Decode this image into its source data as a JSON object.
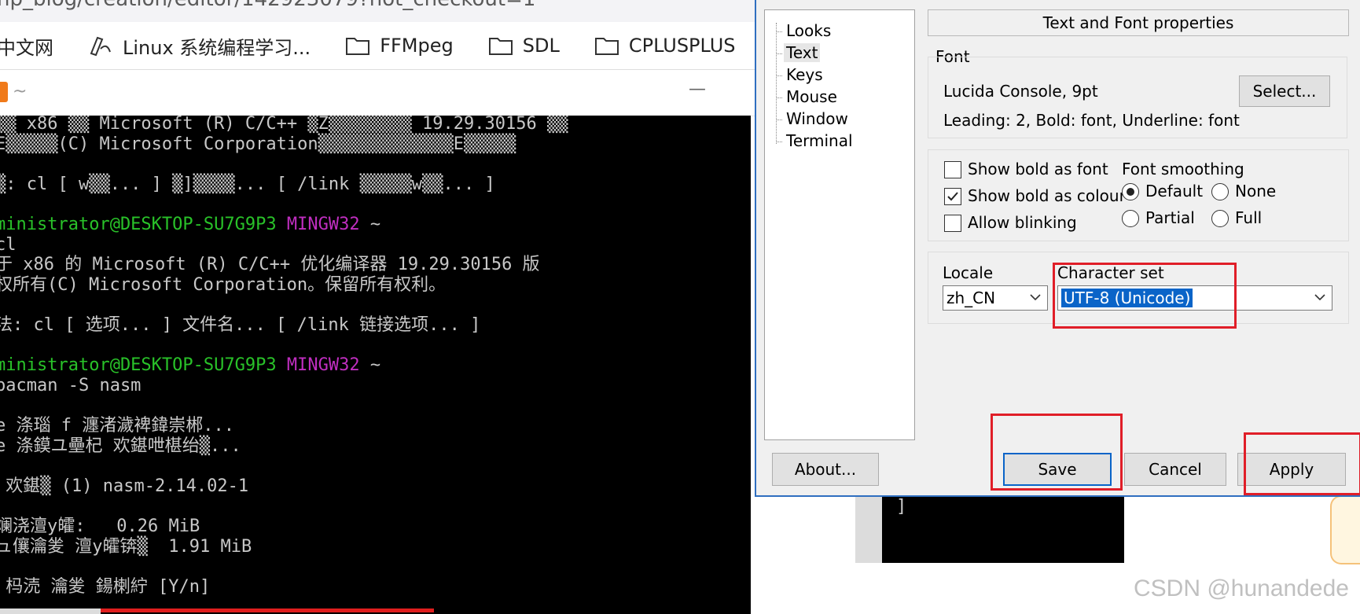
{
  "browser": {
    "url_fragment": "np_blog/creation/editor/142923079?not_checkout=1",
    "bookmarks": [
      {
        "label": "中文网",
        "icon": "none"
      },
      {
        "label": "Linux 系统编程学习...",
        "icon": "pen-icon"
      },
      {
        "label": "FFMpeg",
        "icon": "folder-icon"
      },
      {
        "label": "SDL",
        "icon": "folder-icon"
      },
      {
        "label": "CPLUSPLUS",
        "icon": "folder-icon"
      }
    ]
  },
  "terminal": {
    "title": "~",
    "minimize": "—",
    "lines": [
      {
        "text": "▒▒ x86 ▒▒ Microsoft (R) C/C++ ▒Z▒▒▒▒▒▒▒▒ 19.29.30156 ▒▒",
        "color": "default"
      },
      {
        "text": "E▒▒▒▒▒(C) Microsoft Corporation▒▒▒▒▒▒▒▒▒▒▒▒▒E▒▒▒▒▒",
        "color": "default"
      },
      {
        "text": "",
        "color": "default"
      },
      {
        "text": "▒: cl [ w▒▒... ] ▒]▒▒▒▒... [ /link ▒▒▒▒▒w▒▒... ]",
        "color": "default"
      },
      {
        "text": "",
        "color": "default"
      },
      {
        "prompt_user": "ministrator@DESKTOP-SU7G9P3",
        "prompt_env": "MINGW32",
        "prompt_dir": "~"
      },
      {
        "text": "cl",
        "color": "default"
      },
      {
        "text": "于 x86 的 Microsoft (R) C/C++ 优化编译器 19.29.30156 版",
        "color": "default"
      },
      {
        "text": "权所有(C) Microsoft Corporation。保留所有权利。",
        "color": "default"
      },
      {
        "text": "",
        "color": "default"
      },
      {
        "text": "法: cl [ 选项... ] 文件名... [ /link 链接选项... ]",
        "color": "default"
      },
      {
        "text": "",
        "color": "default"
      },
      {
        "prompt_user": "ministrator@DESKTOP-SU7G9P3",
        "prompt_env": "MINGW32",
        "prompt_dir": "~"
      },
      {
        "text": "pacman -S nasm",
        "color": "default"
      },
      {
        "text": "",
        "color": "default"
      },
      {
        "text": "e 涤瑙 f 瀍渚濊裨鍏崇郴...",
        "color": "default"
      },
      {
        "text": "e 涤鏌ユ壘杞 欢鍖呭椹绐▒...",
        "color": "default"
      },
      {
        "text": "",
        "color": "default"
      },
      {
        "text": " 欢鍖▒ (1) nasm-2.14.02-1",
        "color": "default"
      },
      {
        "text": "",
        "color": "default"
      },
      {
        "text": "斓浇澶у皬:   0.26 MiB",
        "color": "default"
      },
      {
        "text": "ュ儴瀹夎 澶у皬锛▒  1.91 MiB",
        "color": "default"
      },
      {
        "text": "",
        "color": "default"
      },
      {
        "text": " 杩涜 瀹夎 鍚楋紵 [Y/n]",
        "color": "default"
      }
    ],
    "bg_bracket": "]"
  },
  "dialog": {
    "tree": [
      "Looks",
      "Text",
      "Keys",
      "Mouse",
      "Window",
      "Terminal"
    ],
    "selected_tree_index": 1,
    "panel_title": "Text and Font properties",
    "font_group_label": "Font",
    "font_name": "Lucida Console, 9pt",
    "font_details": "Leading: 2, Bold: font, Underline: font",
    "select_button": "Select...",
    "checkboxes": [
      {
        "label": "Show bold as font",
        "checked": false
      },
      {
        "label": "Show bold as colour",
        "checked": true
      },
      {
        "label": "Allow blinking",
        "checked": false
      }
    ],
    "smoothing_label": "Font smoothing",
    "smoothing_options": [
      {
        "label": "Default",
        "selected": true
      },
      {
        "label": "None",
        "selected": false
      },
      {
        "label": "Partial",
        "selected": false
      },
      {
        "label": "Full",
        "selected": false
      }
    ],
    "locale_label": "Locale",
    "locale_value": "zh_CN",
    "charset_label": "Character set",
    "charset_value": "UTF-8 (Unicode)",
    "buttons": {
      "about": "About...",
      "save": "Save",
      "cancel": "Cancel",
      "apply": "Apply"
    },
    "highlight_color": "#e01e28"
  },
  "watermark": "CSDN @hunandede"
}
